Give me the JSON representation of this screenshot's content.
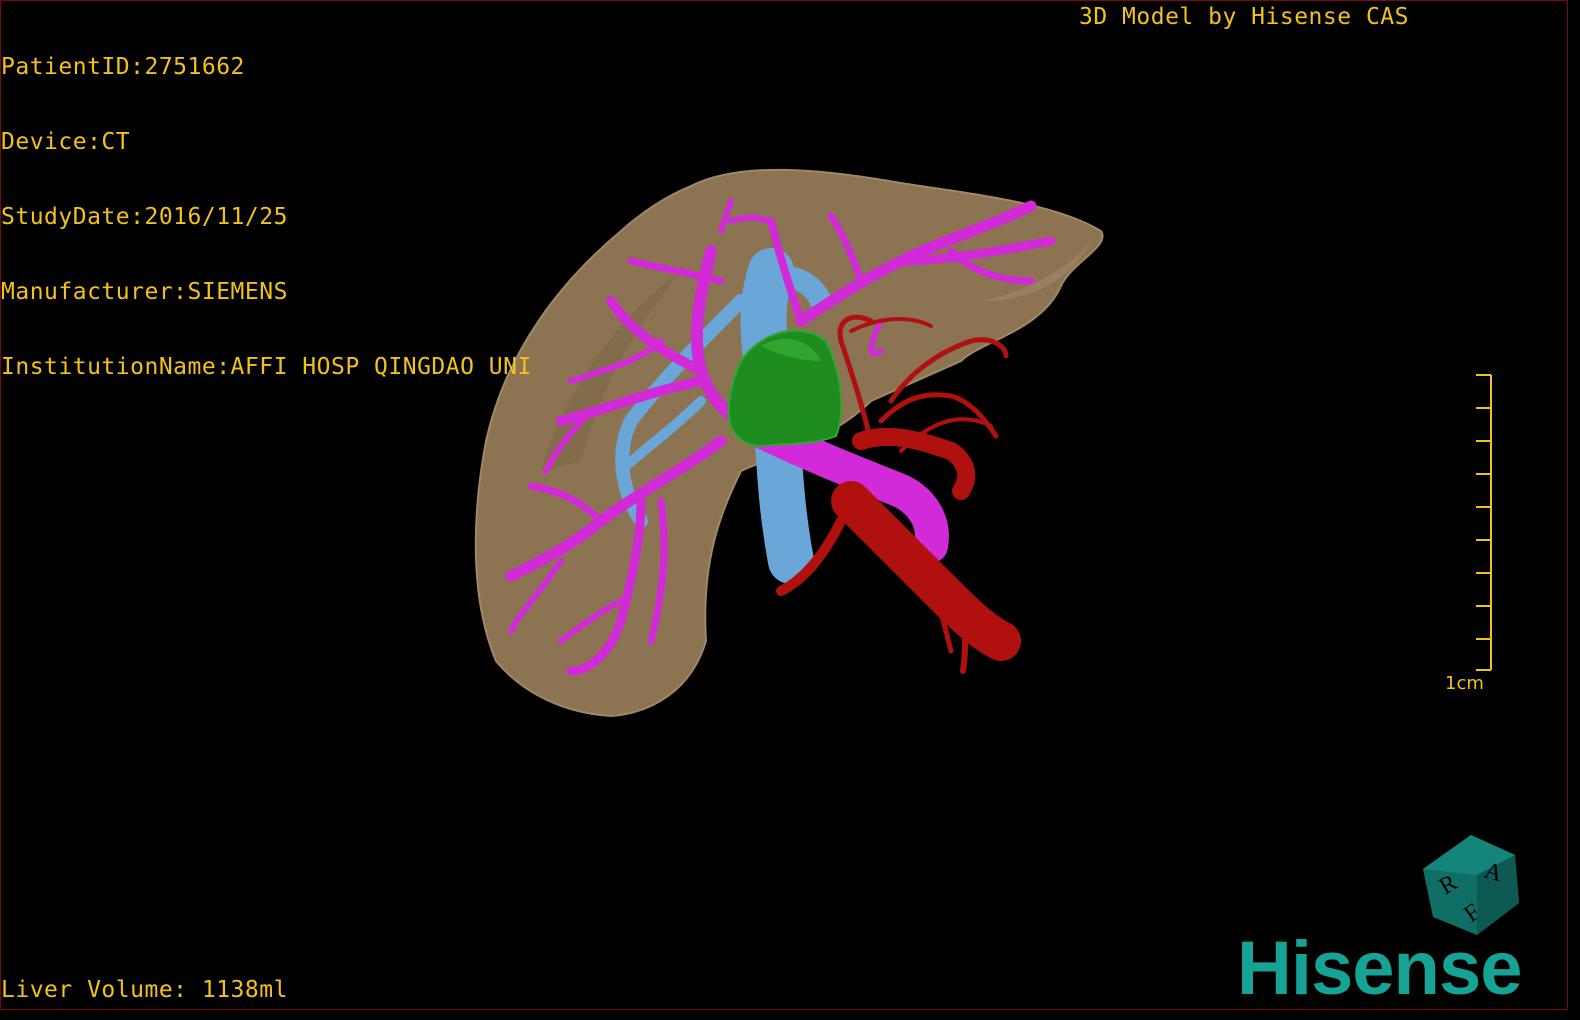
{
  "study_info": {
    "patient_id": "PatientID:2751662",
    "device": "Device:CT",
    "study_date": "StudyDate:2016/11/25",
    "manufacturer": "Manufacturer:SIEMENS",
    "institution": "InstitutionName:AFFI HOSP QINGDAO UNI"
  },
  "credit": "3D Model by Hisense CAS",
  "footer": {
    "liver_volume": "Liver Volume: 1138ml"
  },
  "scale": {
    "label": "1cm"
  },
  "orientation_cube": {
    "faces": [
      "R",
      "A",
      "F"
    ],
    "icon": "orientation-cube-icon"
  },
  "brand": {
    "name": "Hisense"
  },
  "colors": {
    "text": "#f2c21b",
    "liver": "#8c7452",
    "portal_vein": "#d22ad8",
    "hepatic_vein": "#6aa6d8",
    "artery": "#b0100e",
    "lesion": "#1f8c1f",
    "brand": "#16a295"
  }
}
